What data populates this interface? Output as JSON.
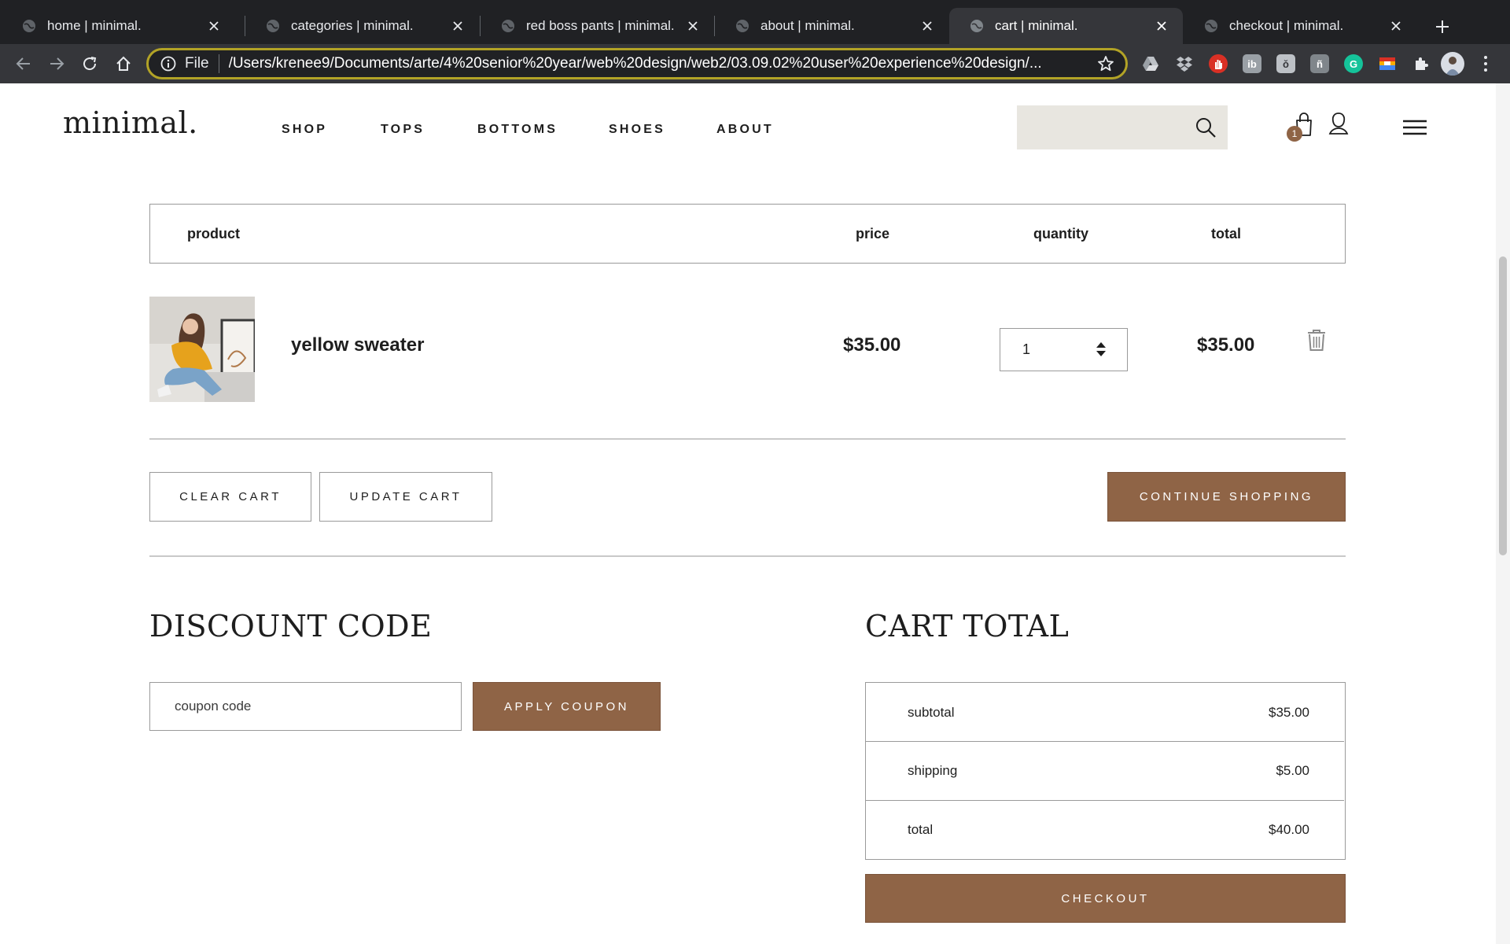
{
  "browser": {
    "tabs": [
      {
        "title": "home | minimal."
      },
      {
        "title": "categories | minimal."
      },
      {
        "title": "red boss pants | minimal."
      },
      {
        "title": "about | minimal."
      },
      {
        "title": "cart | minimal."
      },
      {
        "title": "checkout | minimal."
      }
    ],
    "active_tab": "cart | minimal.",
    "omnibox": {
      "scheme": "File",
      "url": "/Users/krenee9/Documents/arte/4%20senior%20year/web%20design/web2/03.09.02%20user%20experience%20design/..."
    },
    "extension_labels": [
      "ib",
      "ǒ",
      "ñ",
      "G"
    ]
  },
  "site": {
    "logo": "minimal.",
    "nav": [
      "SHOP",
      "TOPS",
      "BOTTOMS",
      "SHOES",
      "ABOUT"
    ],
    "search_placeholder": "",
    "cart_count": "1"
  },
  "cart": {
    "headers": {
      "product": "product",
      "price": "price",
      "quantity": "quantity",
      "total": "total"
    },
    "items": [
      {
        "name": "yellow sweater",
        "price": "$35.00",
        "quantity": "1",
        "total": "$35.00"
      }
    ],
    "buttons": {
      "clear": "CLEAR CART",
      "update": "UPDATE CART",
      "continue": "CONTINUE SHOPPING"
    }
  },
  "discount": {
    "title": "DISCOUNT CODE",
    "placeholder": "coupon code",
    "apply": "APPLY COUPON"
  },
  "totals": {
    "title": "CART TOTAL",
    "rows": [
      {
        "label": "subtotal",
        "value": "$35.00"
      },
      {
        "label": "shipping",
        "value": "$5.00"
      },
      {
        "label": "total",
        "value": "$40.00"
      }
    ],
    "checkout": "CHECKOUT"
  },
  "colors": {
    "accent_brown": "#8f6446",
    "search_bg": "#e8e6e0",
    "border": "#9a9a9a",
    "chrome_dark": "#202124",
    "chrome_toolbar": "#35363a"
  }
}
